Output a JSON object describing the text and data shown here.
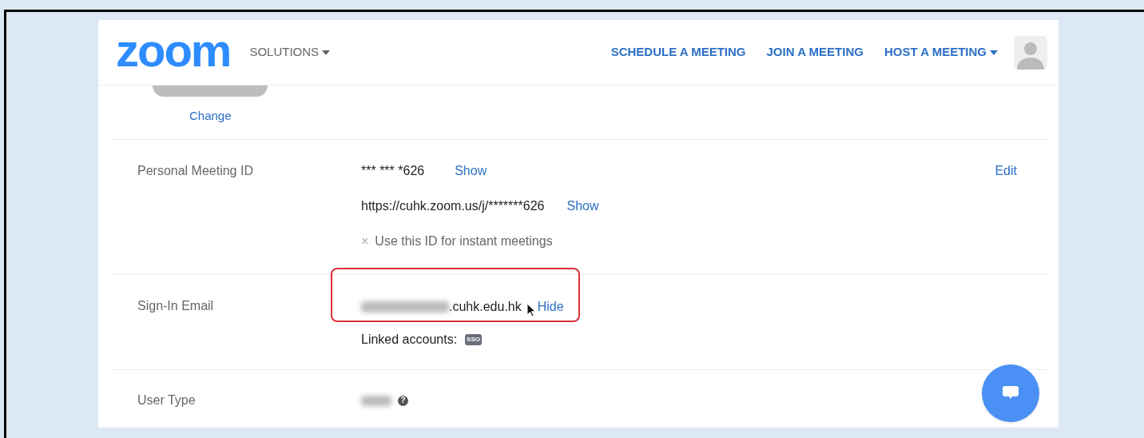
{
  "header": {
    "logo": "zoom",
    "nav_left": [
      {
        "label": "SOLUTIONS",
        "dropdown": true
      }
    ],
    "nav_right": [
      {
        "label": "SCHEDULE A MEETING",
        "dropdown": false
      },
      {
        "label": "JOIN A MEETING",
        "dropdown": false
      },
      {
        "label": "HOST A MEETING",
        "dropdown": true
      }
    ]
  },
  "profile_picture": {
    "change_link": "Change"
  },
  "sections": [
    {
      "kind": "meeting_id",
      "label": "Personal Meeting ID",
      "edit": "Edit",
      "id_value": "*** *** *626",
      "id_show": "Show",
      "url_value": "https://cuhk.zoom.us/j/*******626",
      "url_show": "Show",
      "instant_option": {
        "mark": "×",
        "text": "Use this ID for instant meetings"
      }
    },
    {
      "kind": "email",
      "label": "Sign-In Email",
      "email_suffix": ".cuhk.edu.hk",
      "hide": "Hide",
      "highlighted": true,
      "linked_label": "Linked accounts:",
      "linked_badge": "SSO"
    },
    {
      "kind": "user_type",
      "label": "User Type",
      "help": "?"
    }
  ]
}
